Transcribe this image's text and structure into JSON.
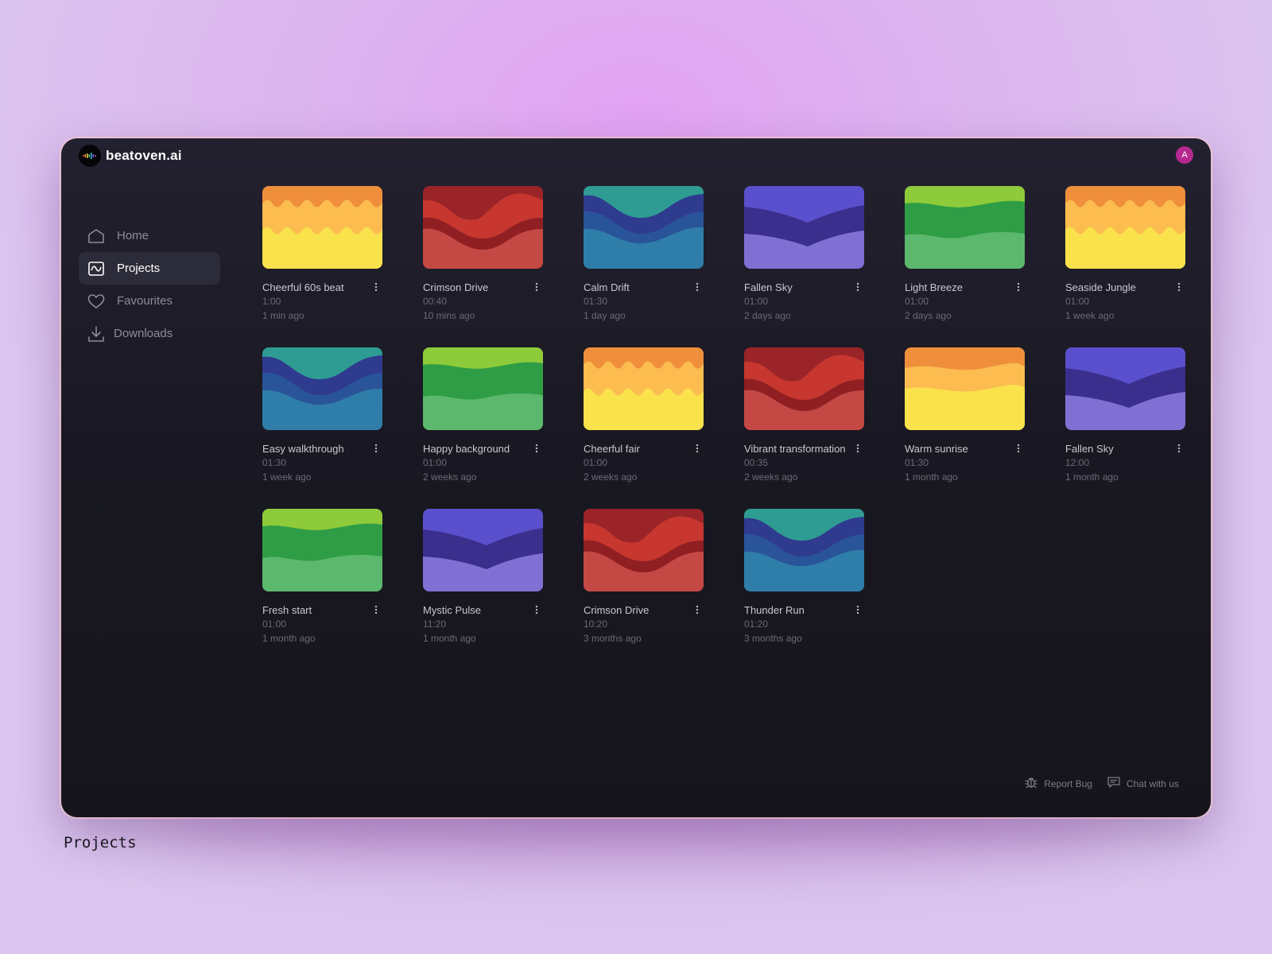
{
  "app": {
    "brand": "beatoven.ai",
    "avatar_initial": "A"
  },
  "sidebar": {
    "items": [
      {
        "label": "Home",
        "icon": "home-icon",
        "active": false
      },
      {
        "label": "Projects",
        "icon": "waveform-icon",
        "active": true
      },
      {
        "label": "Favourites",
        "icon": "heart-icon",
        "active": false
      },
      {
        "label": "Downloads",
        "icon": "download-icon",
        "active": false
      }
    ]
  },
  "projects": [
    {
      "title": "Cheerful 60s beat",
      "duration": "1:00",
      "date": "1 min ago",
      "theme": "sunny"
    },
    {
      "title": "Crimson Drive",
      "duration": "00:40",
      "date": "10 mins ago",
      "theme": "crimson"
    },
    {
      "title": "Calm Drift",
      "duration": "01:30",
      "date": "1 day ago",
      "theme": "ocean"
    },
    {
      "title": "Fallen Sky",
      "duration": "01:00",
      "date": "2 days ago",
      "theme": "violet"
    },
    {
      "title": "Light Breeze",
      "duration": "01:00",
      "date": "2 days ago",
      "theme": "meadow"
    },
    {
      "title": "Seaside Jungle",
      "duration": "01:00",
      "date": "1 week ago",
      "theme": "sunny"
    },
    {
      "title": "Easy walkthrough",
      "duration": "01:30",
      "date": "1 week ago",
      "theme": "ocean"
    },
    {
      "title": "Happy background",
      "duration": "01:00",
      "date": "2 weeks ago",
      "theme": "meadow"
    },
    {
      "title": "Cheerful fair",
      "duration": "01:00",
      "date": "2 weeks ago",
      "theme": "sunny"
    },
    {
      "title": "Vibrant transformation",
      "duration": "00:35",
      "date": "2 weeks ago",
      "theme": "crimson"
    },
    {
      "title": "Warm sunrise",
      "duration": "01:30",
      "date": "1 month ago",
      "theme": "sunrise"
    },
    {
      "title": "Fallen Sky",
      "duration": "12:00",
      "date": "1 month ago",
      "theme": "violet"
    },
    {
      "title": "Fresh start",
      "duration": "01:00",
      "date": "1 month ago",
      "theme": "meadow"
    },
    {
      "title": "Mystic Pulse",
      "duration": "11:20",
      "date": "1 month ago",
      "theme": "violet"
    },
    {
      "title": "Crimson Drive",
      "duration": "10:20",
      "date": "3 months ago",
      "theme": "crimson"
    },
    {
      "title": "Thunder Run",
      "duration": "01:20",
      "date": "3 months ago",
      "theme": "ocean"
    }
  ],
  "footer": {
    "report_bug": "Report Bug",
    "chat": "Chat with us"
  },
  "caption": "Projects",
  "colors": {
    "accent_avatar": "#b6288f",
    "sunny": [
      "#ef8f3c",
      "#fcbc50",
      "#f9e24c"
    ],
    "crimson": [
      "#9a2427",
      "#c7372f",
      "#8f1f22",
      "#c44844"
    ],
    "ocean": [
      "#2f9c93",
      "#2f3b8f",
      "#2a5499",
      "#2f7ea9"
    ],
    "violet": [
      "#5a4fcc",
      "#3a2f8c",
      "#8070d4"
    ],
    "meadow": [
      "#8ecb3a",
      "#2f9d45",
      "#5cb86d"
    ],
    "sunrise": [
      "#ef8f3c",
      "#fcbc50",
      "#f9e24c"
    ]
  }
}
